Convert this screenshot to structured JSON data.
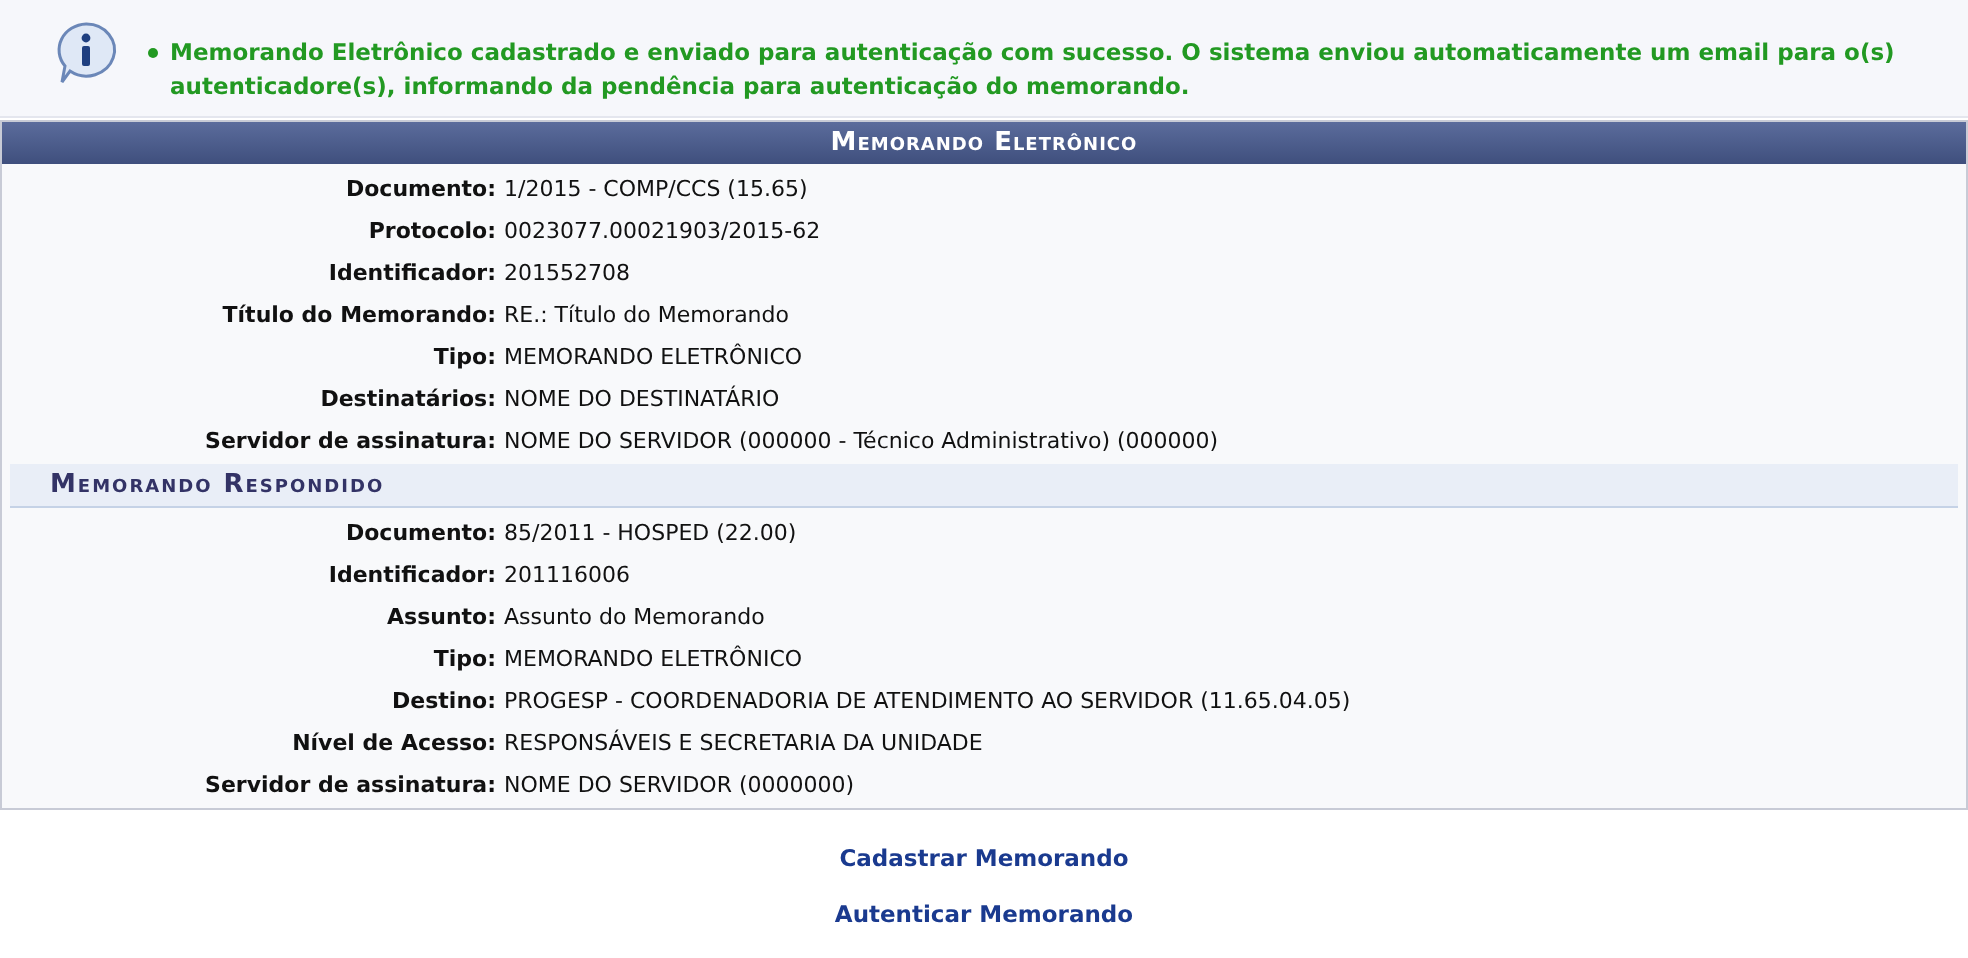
{
  "message": {
    "kind": "success",
    "text": "Memorando Eletrônico cadastrado e enviado para autenticação com sucesso. O sistema enviou automaticamente um email para o(s) autenticadore(s), informando da pendência para autenticação do memorando."
  },
  "panel": {
    "title": "Memorando Eletrônico",
    "fields": [
      {
        "label": "Documento:",
        "value": "1/2015 - COMP/CCS (15.65)"
      },
      {
        "label": "Protocolo:",
        "value": "0023077.00021903/2015-62"
      },
      {
        "label": "Identificador:",
        "value": "201552708"
      },
      {
        "label": "Título do Memorando:",
        "value": "RE.: Título do Memorando"
      },
      {
        "label": "Tipo:",
        "value": "MEMORANDO ELETRÔNICO"
      },
      {
        "label": "Destinatários:",
        "value": "NOME DO DESTINATÁRIO"
      },
      {
        "label": "Servidor de assinatura:",
        "value": "NOME DO SERVIDOR (000000 - Técnico Administrativo) (000000)"
      }
    ],
    "subsection": {
      "title": "Memorando Respondido",
      "fields": [
        {
          "label": "Documento:",
          "value": "85/2011 - HOSPED (22.00)"
        },
        {
          "label": "Identificador:",
          "value": "201116006"
        },
        {
          "label": "Assunto:",
          "value": "Assunto do Memorando"
        },
        {
          "label": "Tipo:",
          "value": "MEMORANDO ELETRÔNICO"
        },
        {
          "label": "Destino:",
          "value": "PROGESP - COORDENADORIA DE ATENDIMENTO AO SERVIDOR (11.65.04.05)"
        },
        {
          "label": "Nível de Acesso:",
          "value": "RESPONSÁVEIS E SECRETARIA DA UNIDADE"
        },
        {
          "label": "Servidor de assinatura:",
          "value": "NOME DO SERVIDOR (0000000)"
        }
      ]
    }
  },
  "links": [
    "Cadastrar Memorando",
    "Autenticar Memorando"
  ]
}
